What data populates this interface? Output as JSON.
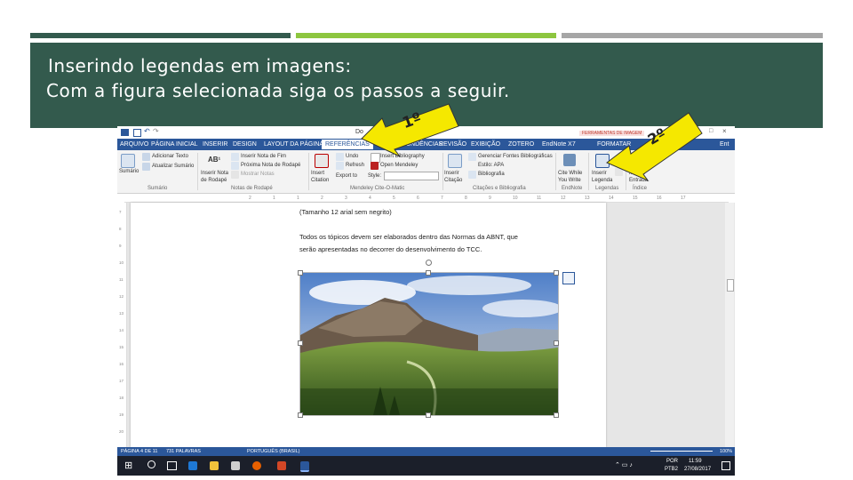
{
  "slide": {
    "accent_bars": [
      "#335a4d",
      "#8dc63f",
      "#a6a6a6"
    ],
    "title_line1": "Inserindo legendas em imagens:",
    "title_line2": "Com a figura selecionada siga os passos a seguir.",
    "step1_label": "1º",
    "step2_label": "2º"
  },
  "word": {
    "title_fragment": "Do",
    "tell_me": "Ent",
    "picture_tools_label": "FERRAMENTAS DE IMAGEM",
    "tabs": [
      "ARQUIVO",
      "PÁGINA INICIAL",
      "INSERIR",
      "DESIGN",
      "LAYOUT DA PÁGINA",
      "REFERÊNCIAS",
      "CORRESPONDÊNCIAS",
      "REVISÃO",
      "EXIBIÇÃO",
      "ZOTERO",
      "EndNote X7",
      "FORMATAR"
    ],
    "ribbon": {
      "sumario": "Sumário",
      "adicionar_texto": "Adicionar Texto",
      "atualizar_sumario": "Atualizar Sumário",
      "inserir_nota_rodape": "Inserir Nota de Rodapé",
      "inserir_nota_fim": "Inserir Nota de Fim",
      "proxima_nota": "Próxima Nota de Rodapé",
      "mostrar_notas": "Mostrar Notas",
      "insert_citation": "Insert Citation",
      "undo": "Undo",
      "refresh": "Refresh",
      "export_to": "Export to",
      "style": "Style:",
      "insert_bibliography": "Insert Bibliography",
      "open_mendeley": "Open Mendeley",
      "inserir_citacao": "Inserir Citação",
      "gerenciar_fontes": "Gerenciar Fontes Bibliográficas",
      "estilo": "Estilo: APA",
      "bibliografia": "Bibliografia",
      "cite_while": "Cite While You Write",
      "inserir_legenda": "Inserir Legenda",
      "marcar_entrada": "Marcar Entrada",
      "groups": {
        "sumario": "Sumário",
        "notas": "Notas de Rodapé",
        "mendeley": "Mendeley Cite-O-Matic",
        "citacoes": "Citações e Bibliografia",
        "endnote": "EndNote",
        "legendas": "Legendas",
        "indice": "Índice"
      }
    },
    "ruler_marks": [
      "2",
      "1",
      "1",
      "2",
      "3",
      "4",
      "5",
      "6",
      "7",
      "8",
      "9",
      "10",
      "11",
      "12",
      "13",
      "14",
      "15",
      "16",
      "17"
    ],
    "vruler_marks": [
      "7",
      "8",
      "9",
      "10",
      "11",
      "12",
      "13",
      "14",
      "15",
      "16",
      "17",
      "18",
      "19",
      "20"
    ],
    "document": {
      "line1": "(Tamanho 12 arial sem negrito)",
      "line2": "Todos os tópicos devem ser elaborados dentro das Normas da ABNT, que",
      "line3": "serão apresentadas no decorrer do desenvolvimento do TCC."
    },
    "status": {
      "page": "PÁGINA 4 DE 11",
      "words": "731 PALAVRAS",
      "language": "PORTUGUÊS (BRASIL)",
      "zoom": "100%"
    },
    "taskbar": {
      "lang1": "POR",
      "lang2": "PTB2",
      "time": "11:59",
      "date": "27/08/2017"
    }
  },
  "colors": {
    "word_blue": "#2b579a",
    "arrow_yellow": "#f5e800",
    "header_green": "#335a4d"
  }
}
